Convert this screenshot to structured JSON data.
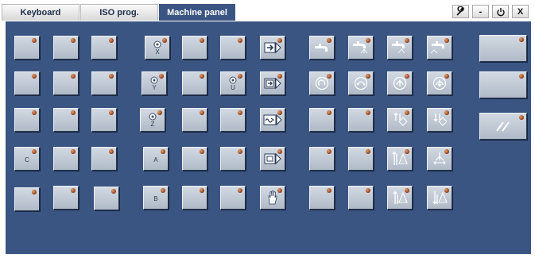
{
  "tabs": [
    {
      "label": "Keyboard",
      "active": false
    },
    {
      "label": "ISO prog.",
      "active": false
    },
    {
      "label": "Machine panel",
      "active": true
    }
  ],
  "window_controls": [
    {
      "name": "wrench-icon",
      "glyph": "🔧"
    },
    {
      "name": "minimize-icon",
      "glyph": "-"
    },
    {
      "name": "power-icon",
      "glyph": "⏻"
    },
    {
      "name": "close-icon",
      "glyph": "X"
    }
  ],
  "keys": {
    "blank_c1r1": "",
    "c_key_label": "C",
    "axis_x_label": "X",
    "axis_y_label": "Y",
    "axis_z_label": "Z",
    "axis_u_label": "U",
    "a_key_label": "A",
    "b_key_label": "B",
    "coolant_1_label": "1",
    "coolant_2_label": "2"
  },
  "colors": {
    "panel": "#3b5583",
    "key": "#c2cad5",
    "led": "#b55a2a",
    "active_tab": "#3b5583"
  }
}
